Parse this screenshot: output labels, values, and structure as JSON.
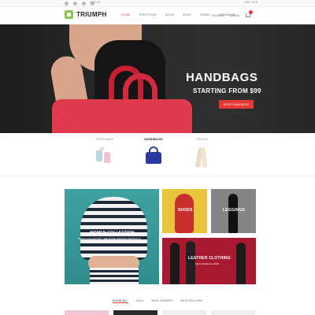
{
  "topbar": {
    "social_icons": [
      "twitter-icon",
      "facebook-icon",
      "google-plus-icon",
      "rss-icon"
    ],
    "left_text": "ENG US",
    "right_links": [
      "USD",
      "EUR"
    ]
  },
  "header": {
    "logo": "TRIUMPH",
    "nav": [
      {
        "label": "HOME",
        "active": true
      },
      {
        "label": "PORTFOLIO",
        "active": false
      },
      {
        "label": "BLOG",
        "active": false
      },
      {
        "label": "SHOP",
        "active": false
      },
      {
        "label": "PAGES",
        "active": false
      },
      {
        "label": "ELEMENTS",
        "active": false
      }
    ],
    "right": {
      "signup": "SIGN UP",
      "login": "LOG IN"
    }
  },
  "hero": {
    "title": "HANDBAGS",
    "subtitle": "STARTING FROM $99",
    "button": "SHOP HANDBAGS"
  },
  "categories": [
    {
      "label": "PERFUMES",
      "active": false
    },
    {
      "label": "HANDBAGS",
      "active": true
    },
    {
      "label": "SHOES",
      "active": false
    }
  ],
  "collections": {
    "women": {
      "title": "WOMEN COLLECTION",
      "subtitle": "ABOUT COLLECTION, SEE MORE AMAZING PRODUCTS"
    },
    "shoes": {
      "title": "SHOES"
    },
    "leggings": {
      "title": "LEGGINGS"
    },
    "leather": {
      "title": "LEATHER CLOTHING",
      "subtitle": "Spring Collection 2016"
    }
  },
  "tabs": [
    {
      "label": "SHOW ALL",
      "active": true
    },
    {
      "label": "SALE",
      "active": false
    },
    {
      "label": "NEW COMERS",
      "active": false
    },
    {
      "label": "BESTSELLERS",
      "active": false
    }
  ],
  "colors": {
    "accent": "#e53935",
    "logo_green": "#8bc34a",
    "bag_red": "#e23a4d",
    "handbag_blue": "#2a3aa3"
  }
}
